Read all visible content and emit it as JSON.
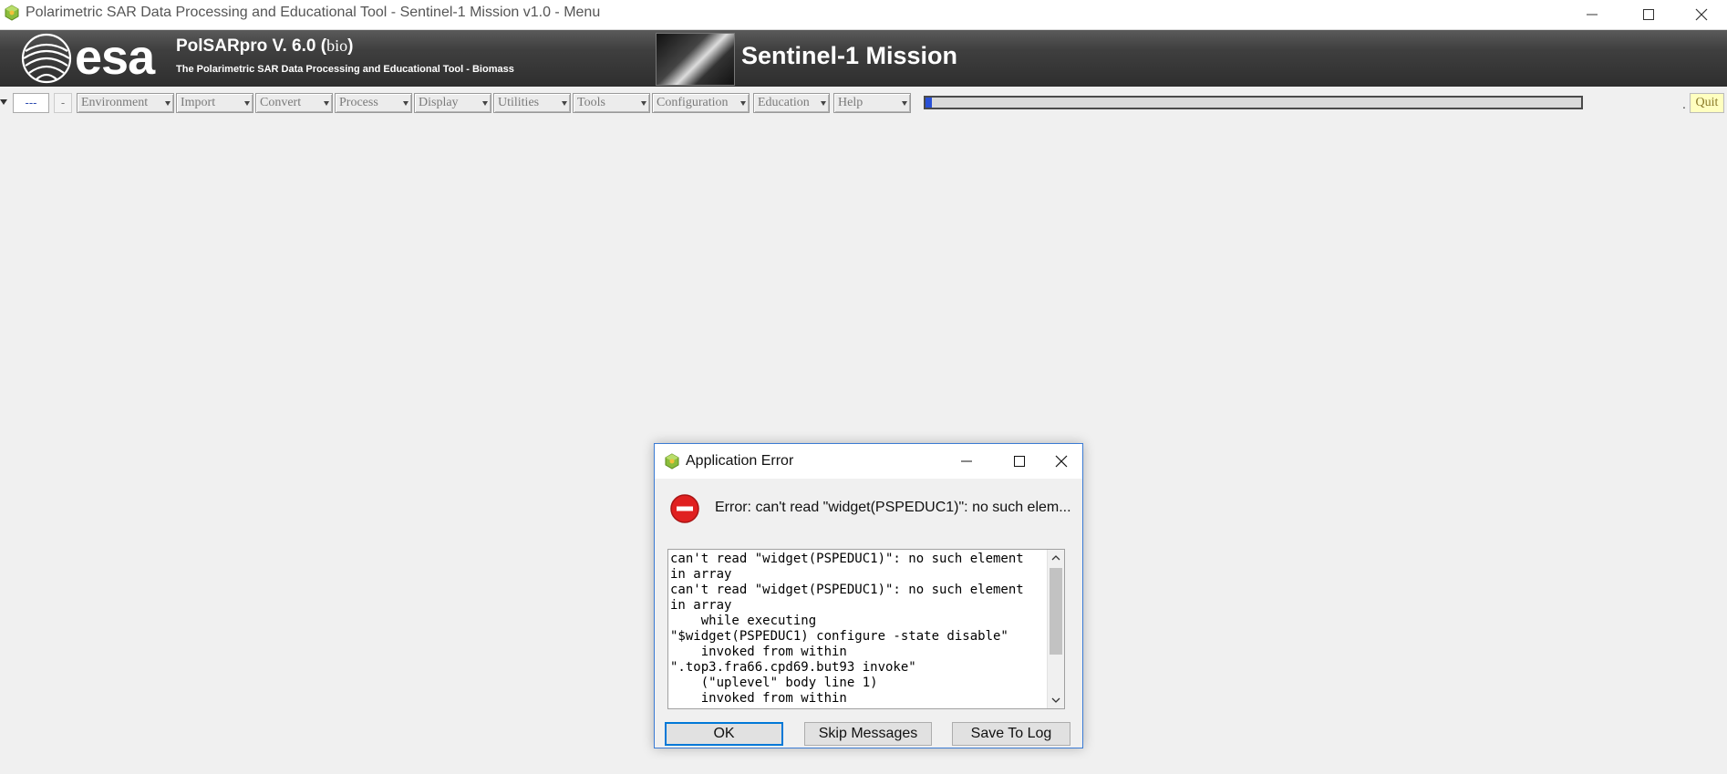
{
  "window": {
    "title": "Polarimetric SAR Data Processing and Educational Tool - Sentinel-1 Mission v1.0 - Menu",
    "icon": "app-cube-icon"
  },
  "banner": {
    "logo_text": "esa",
    "product_title": "PolSARpro V. 6.0 (",
    "product_title_suffix": ")",
    "biomass_logo_text": "bio",
    "subtitle": "The Polarimetric SAR Data Processing and Educational Tool - Biomass",
    "mission_title": "Sentinel-1 Mission"
  },
  "toolbar": {
    "dash_field": "---",
    "dash_button": "-",
    "menus": [
      {
        "label": "Environment"
      },
      {
        "label": "Import"
      },
      {
        "label": "Convert"
      },
      {
        "label": "Process"
      },
      {
        "label": "Display"
      },
      {
        "label": "Utilities"
      },
      {
        "label": "Tools"
      },
      {
        "label": "Configuration"
      },
      {
        "label": "Education"
      },
      {
        "label": "Help"
      }
    ],
    "progress_fraction": 0.01,
    "dot": ".",
    "quit_label": "Quit"
  },
  "dialog": {
    "title": "Application Error",
    "error_message": "Error: can't read \"widget(PSPEDUC1)\": no such elem...",
    "log_lines": [
      "can't read \"widget(PSPEDUC1)\": no such element",
      "in array",
      "can't read \"widget(PSPEDUC1)\": no such element",
      "in array",
      "    while executing",
      "\"$widget(PSPEDUC1) configure -state disable\"",
      "    invoked from within",
      "\".top3.fra66.cpd69.but93 invoke\"",
      "    (\"uplevel\" body line 1)",
      "    invoked from within"
    ],
    "buttons": {
      "ok": "OK",
      "skip": "Skip Messages",
      "save": "Save To Log"
    }
  },
  "colors": {
    "banner_dark": "#2e2e2e",
    "progress_fill": "#2950d6",
    "quit_bg": "#ffffc0",
    "dialog_border": "#3b7bd4",
    "error_red": "#e02020"
  }
}
